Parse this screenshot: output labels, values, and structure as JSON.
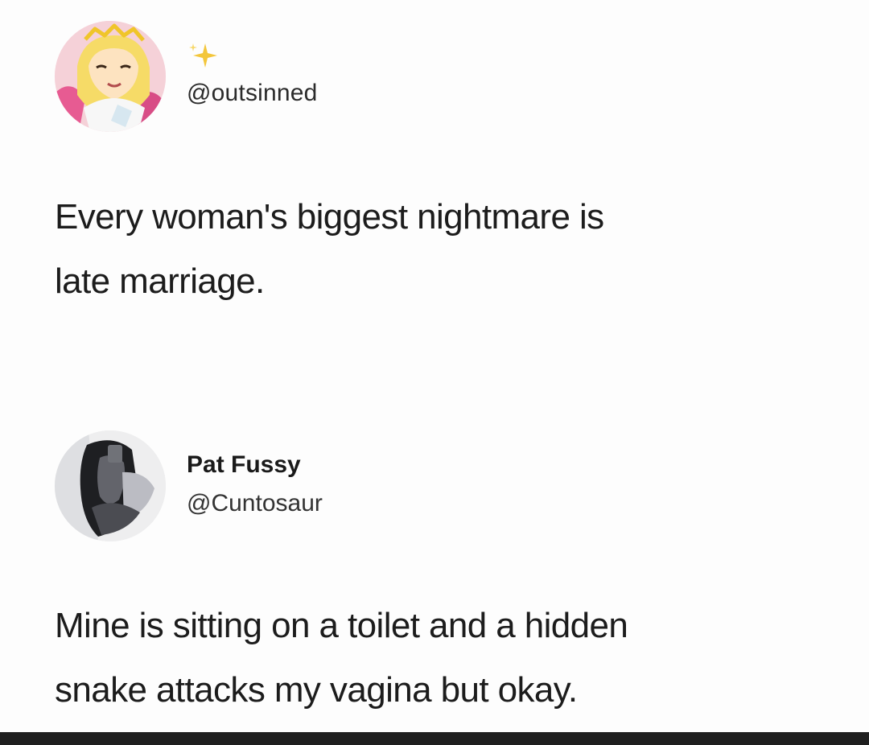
{
  "tweet_1": {
    "avatar_icon": "cartoon-princess-avatar",
    "decoration_icon": "sparkle-icon",
    "handle": "@outsinned",
    "lines": [
      "Every woman's biggest nightmare is",
      "late marriage."
    ]
  },
  "tweet_2": {
    "avatar_icon": "dark-photo-avatar",
    "display_name": "Pat Fussy",
    "handle": "@Cuntosaur",
    "lines": [
      "Mine is sitting on a toilet and a hidden",
      "snake attacks my vagina but okay."
    ]
  },
  "colors": {
    "background": "#fdfdfd",
    "text": "#1c1c1c",
    "bottom_bar": "#1f1f1f",
    "sparkle": "#f3c63b"
  }
}
